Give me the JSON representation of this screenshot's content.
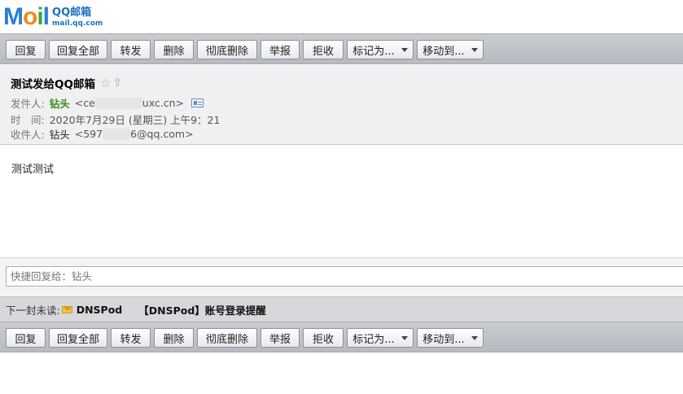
{
  "logo": {
    "brand_m": "M",
    "brand_o": "o",
    "brand_i": "i",
    "brand_l": "l",
    "product_name": "QQ邮箱",
    "domain": "mail.qq.com"
  },
  "toolbar": {
    "reply": "回复",
    "reply_all": "回复全部",
    "forward": "转发",
    "delete": "删除",
    "delete_permanently": "彻底删除",
    "report": "举报",
    "reject": "拒收",
    "mark_as": "标记为...",
    "move_to": "移动到..."
  },
  "message": {
    "subject": "测试发给QQ邮箱",
    "sender_label": "发件人:",
    "sender_name": "钻头",
    "sender_addr_start": "<ce",
    "sender_addr_end": "uxc.cn>",
    "time_label": "时　间:",
    "time_value": "2020年7月29日 (星期三) 上午9：21",
    "recipient_label": "收件人:",
    "recipient_name": "钻头",
    "recipient_addr_start": "<597",
    "recipient_addr_end": "6@qq.com>",
    "body": "测试测试"
  },
  "quick_reply": {
    "placeholder": "快捷回复给：钻头"
  },
  "next_unread": {
    "label": "下一封未读:",
    "sender": "DNSPod",
    "subject": "【DNSPod】账号登录提醒"
  },
  "icons": {
    "star": "star-icon",
    "move_up": "up-arrow-icon",
    "contact_card": "contact-card-icon",
    "envelope": "envelope-icon"
  },
  "colors": {
    "logo_blue": "#2a7fd4",
    "logo_orange": "#f08c1a",
    "logo_green": "#3aa83a",
    "sender_green": "#3d8a1a",
    "toolbar_bg": "#c0c3c8"
  }
}
